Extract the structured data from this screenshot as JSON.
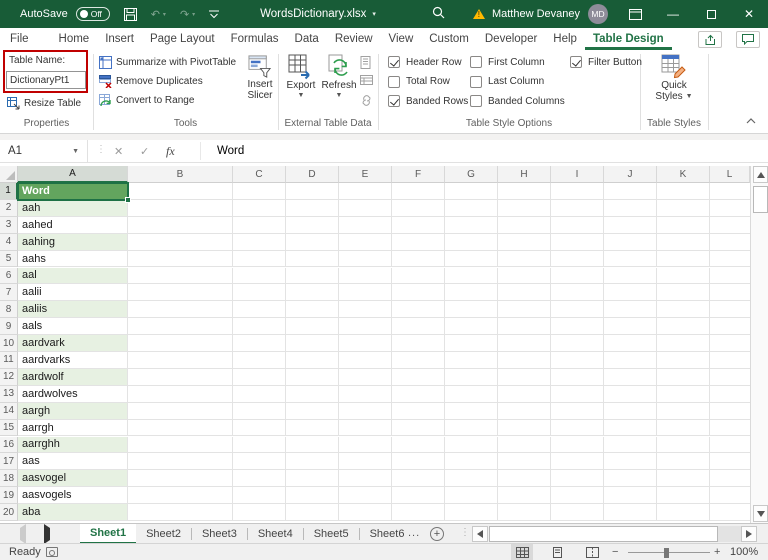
{
  "title_bar": {
    "autosave_label": "AutoSave",
    "autosave_state": "Off",
    "document_title": "WordsDictionary.xlsx",
    "user_name": "Matthew Devaney",
    "user_initials": "MD"
  },
  "ribbon_tabs": {
    "items": [
      "File",
      "Home",
      "Insert",
      "Page Layout",
      "Formulas",
      "Data",
      "Review",
      "View",
      "Custom",
      "Developer",
      "Help",
      "Table Design"
    ],
    "active": "Table Design"
  },
  "ribbon": {
    "properties_group": {
      "label": "Properties",
      "table_name_label": "Table Name:",
      "table_name_value": "DictionaryPt1",
      "resize_table_label": "Resize Table"
    },
    "tools_group": {
      "label": "Tools",
      "buttons": [
        "Summarize with PivotTable",
        "Remove Duplicates",
        "Convert to Range"
      ],
      "insert_slicer_line1": "Insert",
      "insert_slicer_line2": "Slicer"
    },
    "external_group": {
      "label": "External Table Data",
      "export_label": "Export",
      "refresh_label": "Refresh"
    },
    "table_style_options": {
      "label": "Table Style Options",
      "columns": [
        [
          {
            "label": "Header Row",
            "checked": true
          },
          {
            "label": "Total Row",
            "checked": false
          },
          {
            "label": "Banded Rows",
            "checked": true
          }
        ],
        [
          {
            "label": "First Column",
            "checked": false
          },
          {
            "label": "Last Column",
            "checked": false
          },
          {
            "label": "Banded Columns",
            "checked": false
          }
        ],
        [
          {
            "label": "Filter Button",
            "checked": true
          }
        ]
      ]
    },
    "table_styles_group": {
      "label": "Table Styles",
      "quick_styles_line1": "Quick",
      "quick_styles_line2": "Styles"
    }
  },
  "formula_bar": {
    "name_box": "A1",
    "formula": "Word"
  },
  "grid": {
    "column_letters": [
      "A",
      "B",
      "C",
      "D",
      "E",
      "F",
      "G",
      "H",
      "I",
      "J",
      "K",
      "L"
    ],
    "row_numbers": [
      1,
      2,
      3,
      4,
      5,
      6,
      7,
      8,
      9,
      10,
      11,
      12,
      13,
      14,
      15,
      16,
      17,
      18,
      19,
      20
    ],
    "table_header": "Word",
    "words": [
      "aah",
      "aahed",
      "aahing",
      "aahs",
      "aal",
      "aalii",
      "aaliis",
      "aals",
      "aardvark",
      "aardvarks",
      "aardwolf",
      "aardwolves",
      "aargh",
      "aarrgh",
      "aarrghh",
      "aas",
      "aasvogel",
      "aasvogels",
      "aba"
    ]
  },
  "sheet_bar": {
    "tabs": [
      "Sheet1",
      "Sheet2",
      "Sheet3",
      "Sheet4",
      "Sheet5",
      "Sheet6"
    ],
    "active": "Sheet1",
    "more_indicator": "..."
  },
  "status_bar": {
    "mode": "Ready",
    "zoom_level": "100%"
  }
}
